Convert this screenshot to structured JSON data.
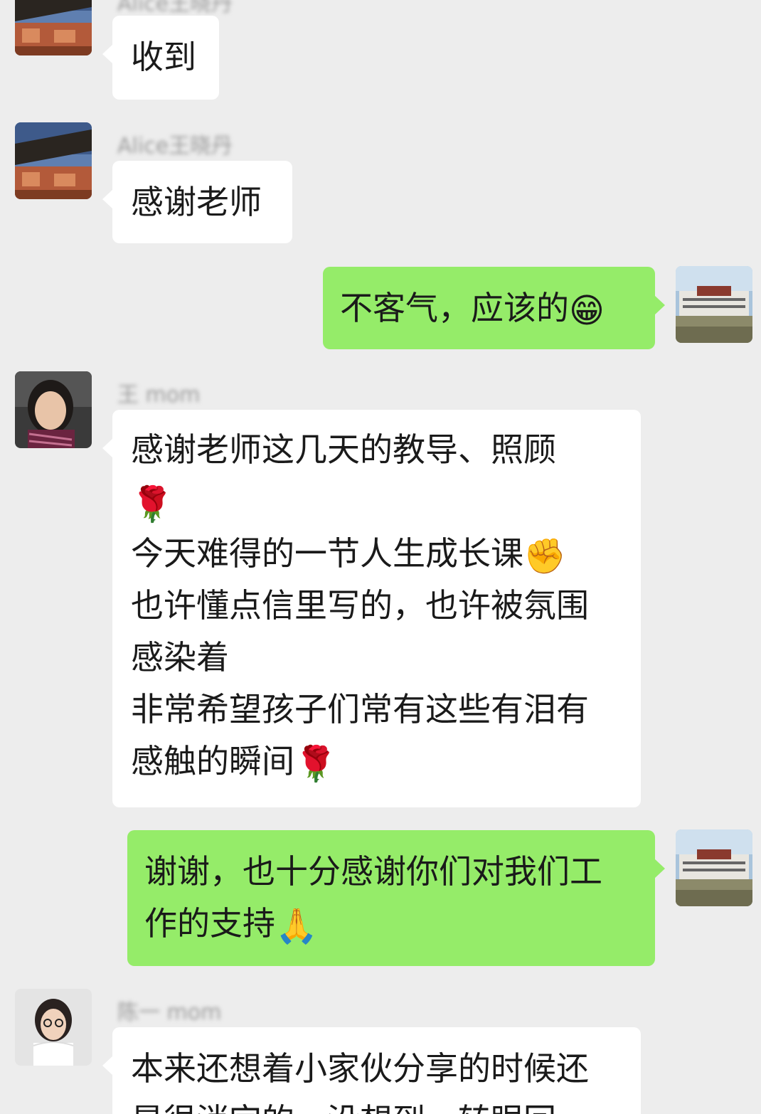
{
  "messages": [
    {
      "sender": "Alice王晓丹",
      "text": "收到",
      "direction": "in"
    },
    {
      "sender": "Alice王晓丹",
      "text": "感谢老师",
      "direction": "in"
    },
    {
      "text": "不客气，应该的",
      "emoji": "😁",
      "direction": "out"
    },
    {
      "sender": "王 mom",
      "direction": "in",
      "lines": [
        {
          "text": "感谢老师这几天的教导、照顾",
          "emoji": ""
        },
        {
          "text": "",
          "emoji": "🌹"
        },
        {
          "text": "今天难得的一节人生成长课",
          "emoji": "✊"
        },
        {
          "text": "也许懂点信里写的，也许被氛围",
          "emoji": ""
        },
        {
          "text": "感染着",
          "emoji": ""
        },
        {
          "text": "非常希望孩子们常有这些有泪有",
          "emoji": ""
        },
        {
          "text": "感触的瞬间",
          "emoji": "🌹"
        }
      ]
    },
    {
      "direction": "out",
      "lines": [
        {
          "text": "谢谢，也十分感谢你们对我们工",
          "emoji": ""
        },
        {
          "text": "作的支持",
          "emoji": "🙏"
        }
      ]
    },
    {
      "sender": "陈一 mom",
      "direction": "in",
      "lines": [
        {
          "text": "本来还想着小家伙分享的时候还",
          "emoji": ""
        },
        {
          "text": "是很消完的，没想到，转眼回",
          "emoji": ""
        }
      ]
    }
  ],
  "colors": {
    "background": "#ededed",
    "incoming_bubble": "#ffffff",
    "outgoing_bubble": "#95ec69"
  }
}
